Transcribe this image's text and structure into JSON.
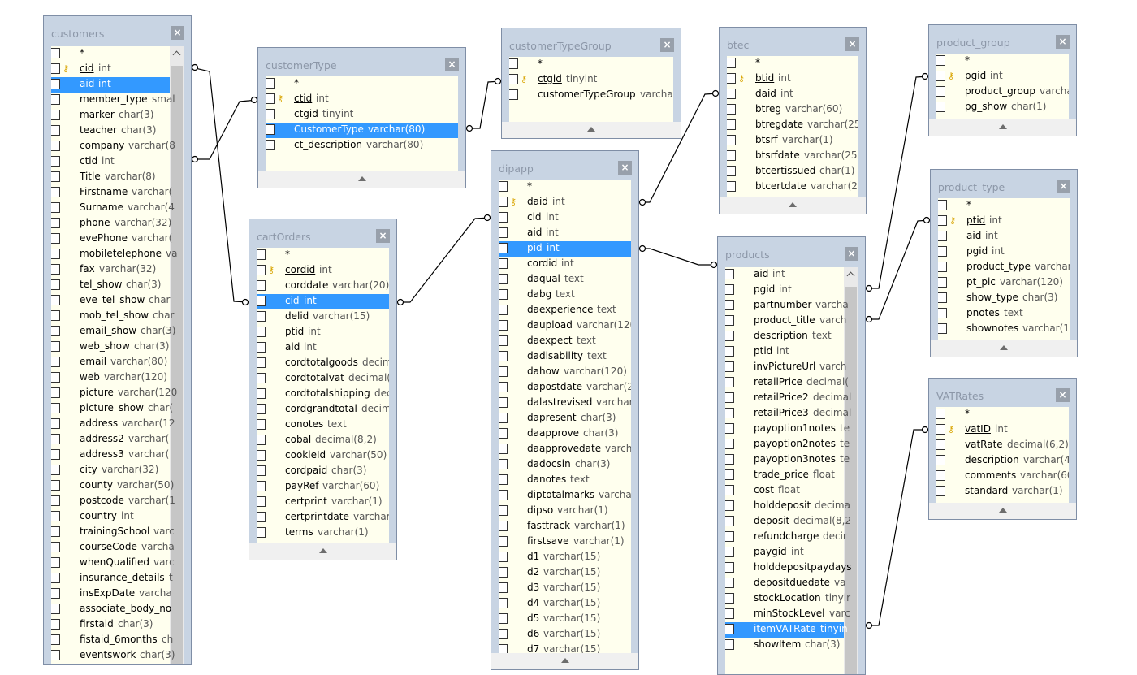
{
  "tables": [
    {
      "id": "customers",
      "title": "customers",
      "scroll": true,
      "fields": [
        {
          "name": "*"
        },
        {
          "name": "cid",
          "type": "int",
          "pk": true
        },
        {
          "name": "aid",
          "type": "int",
          "selected": true
        },
        {
          "name": "member_type",
          "type": "smal"
        },
        {
          "name": "marker",
          "type": "char(3)"
        },
        {
          "name": "teacher",
          "type": "char(3)"
        },
        {
          "name": "company",
          "type": "varchar(8"
        },
        {
          "name": "ctid",
          "type": "int"
        },
        {
          "name": "Title",
          "type": "varchar(8)"
        },
        {
          "name": "Firstname",
          "type": "varchar("
        },
        {
          "name": "Surname",
          "type": "varchar(4"
        },
        {
          "name": "phone",
          "type": "varchar(32)"
        },
        {
          "name": "evePhone",
          "type": "varchar("
        },
        {
          "name": "mobiletelephone",
          "type": "va"
        },
        {
          "name": "fax",
          "type": "varchar(32)"
        },
        {
          "name": "tel_show",
          "type": "char(3)"
        },
        {
          "name": "eve_tel_show",
          "type": "char"
        },
        {
          "name": "mob_tel_show",
          "type": "char"
        },
        {
          "name": "email_show",
          "type": "char(3)"
        },
        {
          "name": "web_show",
          "type": "char(3)"
        },
        {
          "name": "email",
          "type": "varchar(80)"
        },
        {
          "name": "web",
          "type": "varchar(120)"
        },
        {
          "name": "picture",
          "type": "varchar(120"
        },
        {
          "name": "picture_show",
          "type": "char("
        },
        {
          "name": "address",
          "type": "varchar(12"
        },
        {
          "name": "address2",
          "type": "varchar("
        },
        {
          "name": "address3",
          "type": "varchar("
        },
        {
          "name": "city",
          "type": "varchar(32)"
        },
        {
          "name": "county",
          "type": "varchar(50)"
        },
        {
          "name": "postcode",
          "type": "varchar(1"
        },
        {
          "name": "country",
          "type": "int"
        },
        {
          "name": "trainingSchool",
          "type": "varc"
        },
        {
          "name": "courseCode",
          "type": "varcha"
        },
        {
          "name": "whenQualified",
          "type": "varc"
        },
        {
          "name": "insurance_details",
          "type": "t"
        },
        {
          "name": "insExpDate",
          "type": "varcha"
        },
        {
          "name": "associate_body_no",
          "type": ""
        },
        {
          "name": "firstaid",
          "type": "char(3)"
        },
        {
          "name": "fistaid_6months",
          "type": "ch"
        },
        {
          "name": "eventswork",
          "type": "char(3)"
        }
      ]
    },
    {
      "id": "customerType",
      "title": "customerType",
      "fields": [
        {
          "name": "*"
        },
        {
          "name": "ctid",
          "type": "int",
          "pk": true
        },
        {
          "name": "ctgid",
          "type": "tinyint"
        },
        {
          "name": "CustomerType",
          "type": "varchar(80)",
          "selected": true
        },
        {
          "name": "ct_description",
          "type": "varchar(80)"
        }
      ]
    },
    {
      "id": "customerTypeGroup",
      "title": "customerTypeGroup",
      "fields": [
        {
          "name": "*"
        },
        {
          "name": "ctgid",
          "type": "tinyint",
          "pk": true
        },
        {
          "name": "customerTypeGroup",
          "type": "varchar("
        }
      ]
    },
    {
      "id": "btec",
      "title": "btec",
      "fields": [
        {
          "name": "*"
        },
        {
          "name": "btid",
          "type": "int",
          "pk": true
        },
        {
          "name": "daid",
          "type": "int"
        },
        {
          "name": "btreg",
          "type": "varchar(60)"
        },
        {
          "name": "btregdate",
          "type": "varchar(25)"
        },
        {
          "name": "btsrf",
          "type": "varchar(1)"
        },
        {
          "name": "btsrfdate",
          "type": "varchar(25)"
        },
        {
          "name": "btcertissued",
          "type": "char(1)"
        },
        {
          "name": "btcertdate",
          "type": "varchar(25"
        }
      ]
    },
    {
      "id": "product_group",
      "title": "product_group",
      "fields": [
        {
          "name": "*"
        },
        {
          "name": "pgid",
          "type": "int",
          "pk": true
        },
        {
          "name": "product_group",
          "type": "varcha"
        },
        {
          "name": "pg_show",
          "type": "char(1)"
        }
      ]
    },
    {
      "id": "product_type",
      "title": "product_type",
      "fields": [
        {
          "name": "*"
        },
        {
          "name": "ptid",
          "type": "int",
          "pk": true
        },
        {
          "name": "aid",
          "type": "int"
        },
        {
          "name": "pgid",
          "type": "int"
        },
        {
          "name": "product_type",
          "type": "varchar("
        },
        {
          "name": "pt_pic",
          "type": "varchar(120)"
        },
        {
          "name": "show_type",
          "type": "char(3)"
        },
        {
          "name": "pnotes",
          "type": "text"
        },
        {
          "name": "shownotes",
          "type": "varchar(1)"
        }
      ]
    },
    {
      "id": "VATRates",
      "title": "VATRates",
      "fields": [
        {
          "name": "*"
        },
        {
          "name": "vatID",
          "type": "int",
          "pk": true
        },
        {
          "name": "vatRate",
          "type": "decimal(6,2)"
        },
        {
          "name": "description",
          "type": "varchar(40"
        },
        {
          "name": "comments",
          "type": "varchar(60)"
        },
        {
          "name": "standard",
          "type": "varchar(1)"
        }
      ]
    },
    {
      "id": "cartOrders",
      "title": "cartOrders",
      "fields": [
        {
          "name": "*"
        },
        {
          "name": "cordid",
          "type": "int",
          "pk": true
        },
        {
          "name": "corddate",
          "type": "varchar(20)"
        },
        {
          "name": "cid",
          "type": "int",
          "selected": true
        },
        {
          "name": "delid",
          "type": "varchar(15)"
        },
        {
          "name": "ptid",
          "type": "int"
        },
        {
          "name": "aid",
          "type": "int"
        },
        {
          "name": "cordtotalgoods",
          "type": "decima"
        },
        {
          "name": "cordtotalvat",
          "type": "decimal(8"
        },
        {
          "name": "cordtotalshipping",
          "type": "decir"
        },
        {
          "name": "cordgrandtotal",
          "type": "decima"
        },
        {
          "name": "conotes",
          "type": "text"
        },
        {
          "name": "cobal",
          "type": "decimal(8,2)"
        },
        {
          "name": "cookieId",
          "type": "varchar(50)"
        },
        {
          "name": "cordpaid",
          "type": "char(3)"
        },
        {
          "name": "payRef",
          "type": "varchar(60)"
        },
        {
          "name": "certprint",
          "type": "varchar(1)"
        },
        {
          "name": "certprintdate",
          "type": "varchar("
        },
        {
          "name": "terms",
          "type": "varchar(1)"
        }
      ]
    },
    {
      "id": "dipapp",
      "title": "dipapp",
      "fields": [
        {
          "name": "*"
        },
        {
          "name": "daid",
          "type": "int",
          "pk": true
        },
        {
          "name": "cid",
          "type": "int"
        },
        {
          "name": "aid",
          "type": "int"
        },
        {
          "name": "pid",
          "type": "int",
          "selected": true
        },
        {
          "name": "cordid",
          "type": "int"
        },
        {
          "name": "daqual",
          "type": "text"
        },
        {
          "name": "dabg",
          "type": "text"
        },
        {
          "name": "daexperience",
          "type": "text"
        },
        {
          "name": "daupload",
          "type": "varchar(120"
        },
        {
          "name": "daexpect",
          "type": "text"
        },
        {
          "name": "dadisability",
          "type": "text"
        },
        {
          "name": "dahow",
          "type": "varchar(120)"
        },
        {
          "name": "dapostdate",
          "type": "varchar(2"
        },
        {
          "name": "dalastrevised",
          "type": "varchar("
        },
        {
          "name": "dapresent",
          "type": "char(3)"
        },
        {
          "name": "daapprove",
          "type": "char(3)"
        },
        {
          "name": "daapprovedate",
          "type": "varcha"
        },
        {
          "name": "dadocsin",
          "type": "char(3)"
        },
        {
          "name": "danotes",
          "type": "text"
        },
        {
          "name": "diptotalmarks",
          "type": "varchar("
        },
        {
          "name": "dipso",
          "type": "varchar(1)"
        },
        {
          "name": "fasttrack",
          "type": "varchar(1)"
        },
        {
          "name": "firstsave",
          "type": "varchar(1)"
        },
        {
          "name": "d1",
          "type": "varchar(15)"
        },
        {
          "name": "d2",
          "type": "varchar(15)"
        },
        {
          "name": "d3",
          "type": "varchar(15)"
        },
        {
          "name": "d4",
          "type": "varchar(15)"
        },
        {
          "name": "d5",
          "type": "varchar(15)"
        },
        {
          "name": "d6",
          "type": "varchar(15)"
        },
        {
          "name": "d7",
          "type": "varchar(15)"
        }
      ]
    },
    {
      "id": "products",
      "title": "products",
      "scroll": true,
      "fields": [
        {
          "name": "aid",
          "type": "int"
        },
        {
          "name": "pgid",
          "type": "int"
        },
        {
          "name": "partnumber",
          "type": "varcha"
        },
        {
          "name": "product_title",
          "type": "varch"
        },
        {
          "name": "description",
          "type": "text"
        },
        {
          "name": "ptid",
          "type": "int"
        },
        {
          "name": "invPictureUrl",
          "type": "varch"
        },
        {
          "name": "retailPrice",
          "type": "decimal("
        },
        {
          "name": "retailPrice2",
          "type": "decimal"
        },
        {
          "name": "retailPrice3",
          "type": "decimal"
        },
        {
          "name": "payoption1notes",
          "type": "te"
        },
        {
          "name": "payoption2notes",
          "type": "te"
        },
        {
          "name": "payoption3notes",
          "type": "te"
        },
        {
          "name": "trade_price",
          "type": "float"
        },
        {
          "name": "cost",
          "type": "float"
        },
        {
          "name": "holddeposit",
          "type": "decima"
        },
        {
          "name": "deposit",
          "type": "decimal(8,2"
        },
        {
          "name": "refundcharge",
          "type": "decir"
        },
        {
          "name": "paygid",
          "type": "int"
        },
        {
          "name": "holddepositpaydays",
          "type": ""
        },
        {
          "name": "depositduedate",
          "type": "va"
        },
        {
          "name": "stockLocation",
          "type": "tinyir"
        },
        {
          "name": "minStockLevel",
          "type": "varc"
        },
        {
          "name": "itemVATRate",
          "type": "tinyin",
          "selected": true
        },
        {
          "name": "showItem",
          "type": "char(3)"
        }
      ]
    }
  ]
}
